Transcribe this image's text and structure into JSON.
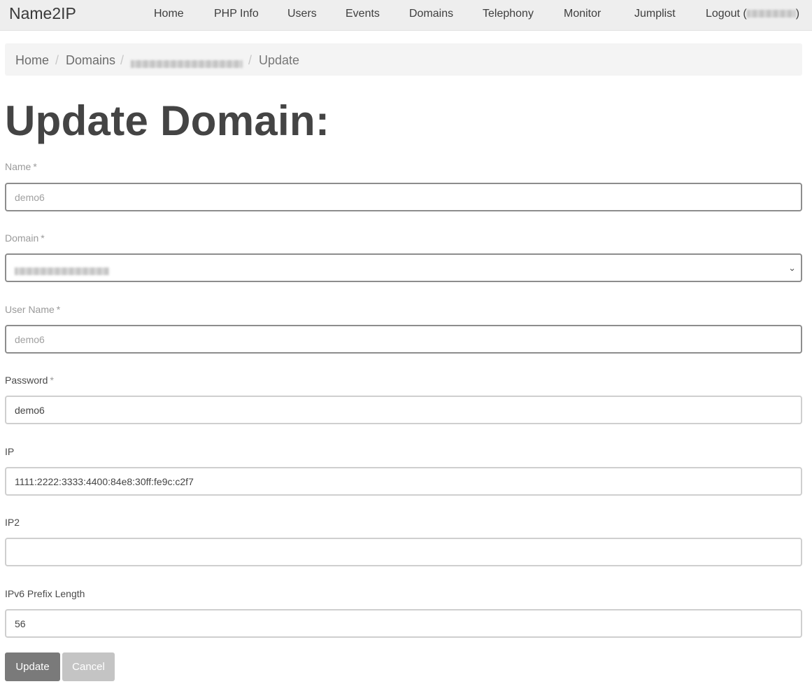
{
  "navbar": {
    "brand": "Name2IP",
    "items": [
      {
        "label": "Home"
      },
      {
        "label": "PHP Info"
      },
      {
        "label": "Users"
      },
      {
        "label": "Events"
      },
      {
        "label": "Domains"
      },
      {
        "label": "Telephony"
      },
      {
        "label": "Monitor"
      },
      {
        "label": "Jumplist"
      }
    ],
    "logout_prefix": "Logout (",
    "logout_suffix": ")"
  },
  "breadcrumb": {
    "home": "Home",
    "domains": "Domains",
    "separator": "/",
    "active": "Update"
  },
  "page": {
    "title": "Update Domain:"
  },
  "form": {
    "name": {
      "label": "Name",
      "required_mark": "*",
      "value": "demo6"
    },
    "domain": {
      "label": "Domain",
      "required_mark": "*"
    },
    "user_name": {
      "label": "User Name",
      "required_mark": "*",
      "value": "demo6"
    },
    "password": {
      "label": "Password",
      "required_mark": "*",
      "value": "demo6"
    },
    "ip": {
      "label": "IP",
      "value": "1111:2222:3333:4400:84e8:30ff:fe9c:c2f7"
    },
    "ip2": {
      "label": "IP2",
      "value": ""
    },
    "ipv6_prefix": {
      "label": "IPv6 Prefix Length",
      "value": "56"
    }
  },
  "buttons": {
    "update": "Update",
    "cancel": "Cancel"
  },
  "colors": {
    "navbar_bg": "#eeeeee",
    "breadcrumb_bg": "#f4f4f4",
    "update_button": "#7a7a7a",
    "cancel_button": "#c4c4c4",
    "required_border": "#8d8d8d"
  }
}
